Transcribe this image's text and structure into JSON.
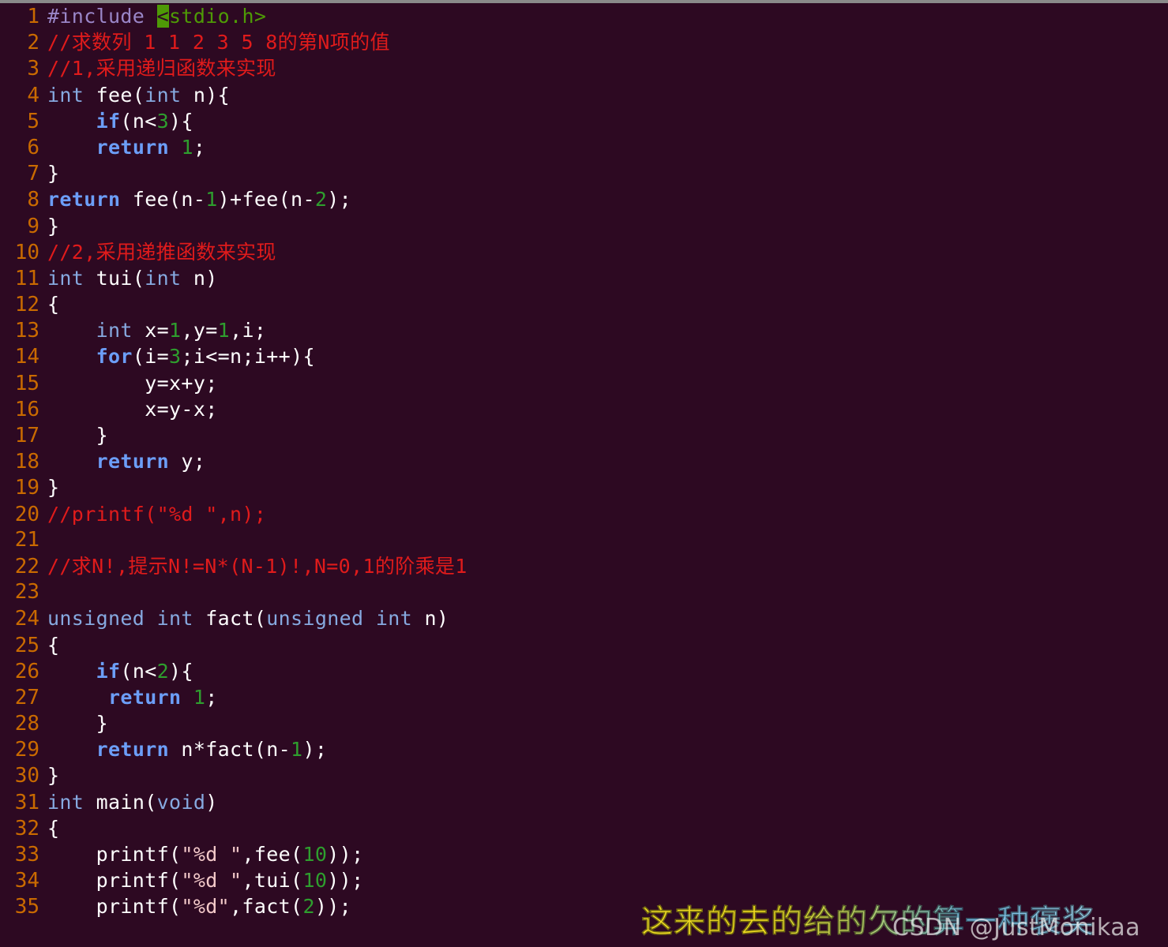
{
  "editor": {
    "language": "C",
    "background_color": "#2d0922",
    "gutter_color": "#c96a00",
    "total_lines": 35,
    "cursor": {
      "line": 1,
      "column": 10,
      "char": "<",
      "block_color": "#4e9a06"
    },
    "lines": [
      {
        "number": "1",
        "text": "#include <stdio.h>"
      },
      {
        "number": "2",
        "text": "//求数列 1 1 2 3 5 8的第N项的值"
      },
      {
        "number": "3",
        "text": "//1,采用递归函数来实现"
      },
      {
        "number": "4",
        "text": "int fee(int n){"
      },
      {
        "number": "5",
        "text": "    if(n<3){"
      },
      {
        "number": "6",
        "text": "    return 1;"
      },
      {
        "number": "7",
        "text": "}"
      },
      {
        "number": "8",
        "text": "return fee(n-1)+fee(n-2);"
      },
      {
        "number": "9",
        "text": "}"
      },
      {
        "number": "10",
        "text": "//2,采用递推函数来实现"
      },
      {
        "number": "11",
        "text": "int tui(int n)"
      },
      {
        "number": "12",
        "text": "{"
      },
      {
        "number": "13",
        "text": "    int x=1,y=1,i;"
      },
      {
        "number": "14",
        "text": "    for(i=3;i<=n;i++){"
      },
      {
        "number": "15",
        "text": "        y=x+y;"
      },
      {
        "number": "16",
        "text": "        x=y-x;"
      },
      {
        "number": "17",
        "text": "    }"
      },
      {
        "number": "18",
        "text": "    return y;"
      },
      {
        "number": "19",
        "text": "}"
      },
      {
        "number": "20",
        "text": "//printf(\"%d \",n);"
      },
      {
        "number": "21",
        "text": ""
      },
      {
        "number": "22",
        "text": "//求N!,提示N!=N*(N-1)!,N=0,1的阶乘是1"
      },
      {
        "number": "23",
        "text": ""
      },
      {
        "number": "24",
        "text": "unsigned int fact(unsigned int n)"
      },
      {
        "number": "25",
        "text": "{"
      },
      {
        "number": "26",
        "text": "    if(n<2){"
      },
      {
        "number": "27",
        "text": "     return 1;"
      },
      {
        "number": "28",
        "text": "    }"
      },
      {
        "number": "29",
        "text": "    return n*fact(n-1);"
      },
      {
        "number": "30",
        "text": "}"
      },
      {
        "number": "31",
        "text": "int main(void)"
      },
      {
        "number": "32",
        "text": "{"
      },
      {
        "number": "33",
        "text": "    printf(\"%d \",fee(10));"
      },
      {
        "number": "34",
        "text": "    printf(\"%d \",tui(10));"
      },
      {
        "number": "35",
        "text": "    printf(\"%d\",fact(2));"
      }
    ]
  },
  "overlay": {
    "caption": "这来的去的给的欠的算一种褒奖",
    "caption_gradient_from": "#f5e024",
    "caption_gradient_to": "#9fd3ef",
    "watermark": "CSDN @JustMonikaa"
  }
}
